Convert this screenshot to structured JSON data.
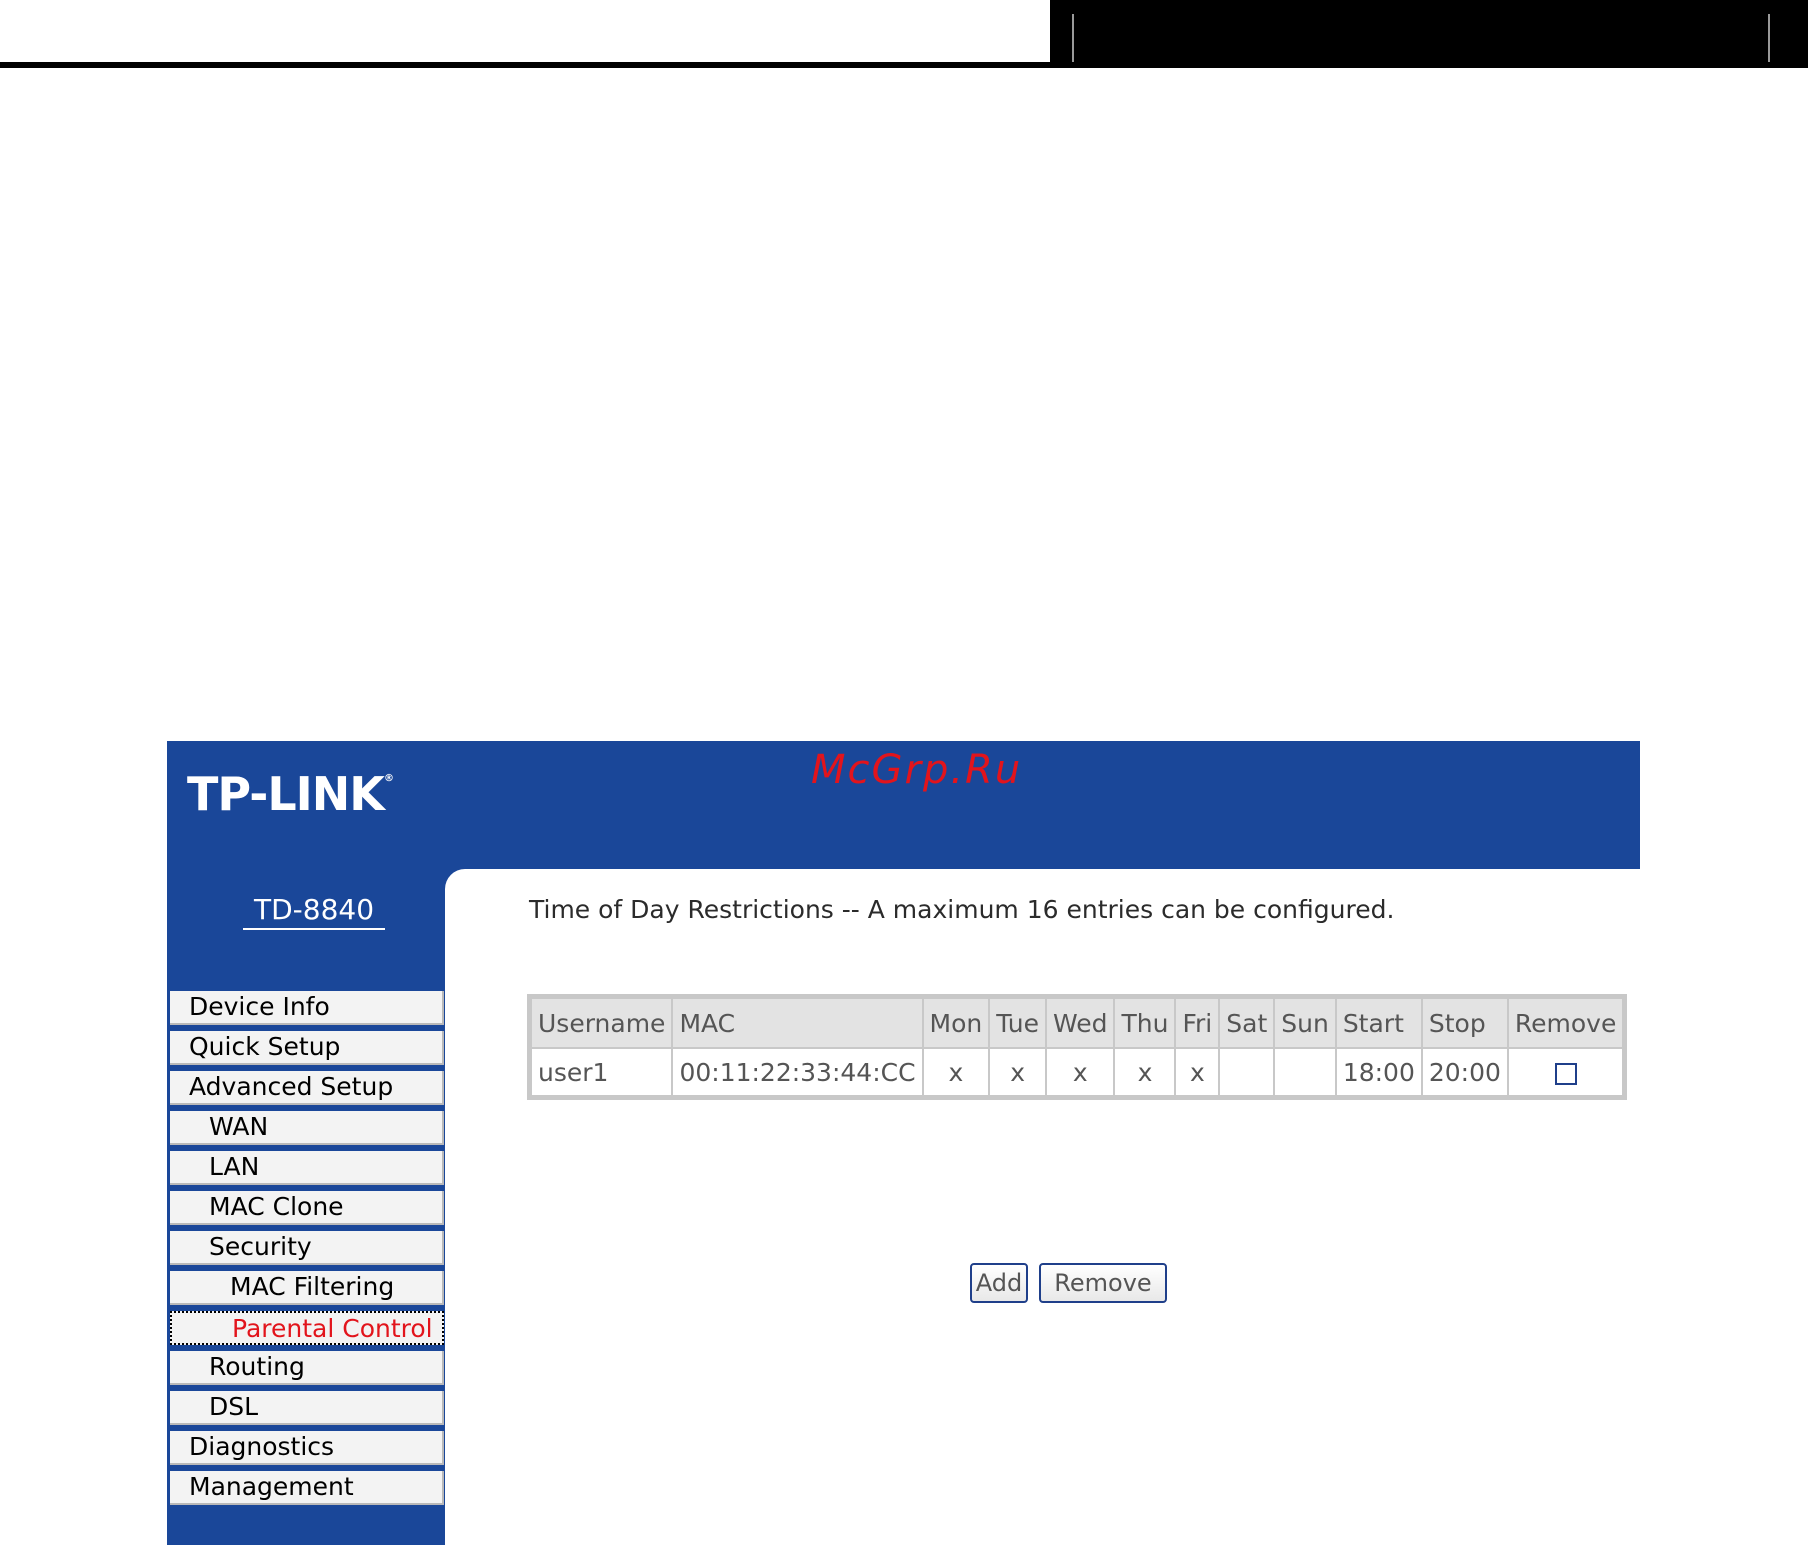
{
  "router": {
    "logo": "TP-LINK",
    "logo_mark": "®",
    "watermark": "McGrp.Ru",
    "model": "TD-8840"
  },
  "menu": [
    {
      "label": "Device Info",
      "level": 1
    },
    {
      "label": "Quick Setup",
      "level": 1
    },
    {
      "label": "Advanced Setup",
      "level": 1
    },
    {
      "label": "WAN",
      "level": 2
    },
    {
      "label": "LAN",
      "level": 2
    },
    {
      "label": "MAC Clone",
      "level": 2
    },
    {
      "label": "Security",
      "level": 2
    },
    {
      "label": "MAC Filtering",
      "level": 3
    },
    {
      "label": "Parental Control",
      "level": 3,
      "active": true
    },
    {
      "label": "Routing",
      "level": 2
    },
    {
      "label": "DSL",
      "level": 2
    },
    {
      "label": "Diagnostics",
      "level": 1
    },
    {
      "label": "Management",
      "level": 1
    }
  ],
  "content": {
    "title": "Time of Day Restrictions -- A maximum 16 entries can be configured.",
    "columns": [
      "Username",
      "MAC",
      "Mon",
      "Tue",
      "Wed",
      "Thu",
      "Fri",
      "Sat",
      "Sun",
      "Start",
      "Stop",
      "Remove"
    ],
    "rows": [
      {
        "username": "user1",
        "mac": "00:11:22:33:44:CC",
        "mon": "x",
        "tue": "x",
        "wed": "x",
        "thu": "x",
        "fri": "x",
        "sat": "",
        "sun": "",
        "start": "18:00",
        "stop": "20:00",
        "remove_checked": false
      }
    ],
    "buttons": {
      "add": "Add",
      "remove": "Remove"
    }
  },
  "colors": {
    "brand_blue": "#1a4799",
    "active_red": "#e2141c"
  }
}
